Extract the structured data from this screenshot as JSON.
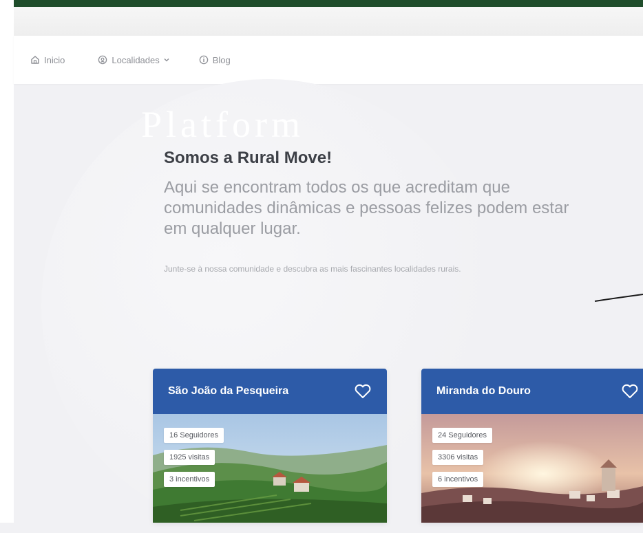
{
  "nav": {
    "items": [
      {
        "label": "Inicio",
        "icon": "home-icon"
      },
      {
        "label": "Localidades",
        "icon": "map-pin-icon",
        "dropdown": true
      },
      {
        "label": "Blog",
        "icon": "info-icon"
      }
    ]
  },
  "hero": {
    "watermark": "Platform",
    "title": "Somos a Rural Move!",
    "lead": "Aqui se encontram todos os que acreditam que comunidades dinâmicas e pessoas felizes podem estar em qualquer lugar.",
    "subtext": "Junte-se à nossa comunidade e descubra as mais fascinantes localidades rurais."
  },
  "cards": [
    {
      "name": "São João da Pesqueira",
      "followers": "16 Seguidores",
      "visits": "1925 visitas",
      "incentives": "3 incentivos",
      "favorite_icon": "heart-icon"
    },
    {
      "name": "Miranda do Douro",
      "followers": "24 Seguidores",
      "visits": "3306 visitas",
      "incentives": "6 incentivos",
      "favorite_icon": "heart-icon"
    }
  ],
  "colors": {
    "top_bar": "#1f4d2b",
    "card_header": "#2d5ba8",
    "background": "#f1f1f4"
  }
}
